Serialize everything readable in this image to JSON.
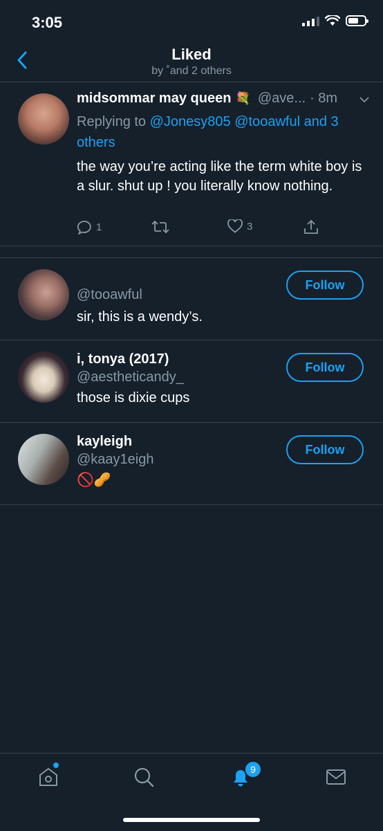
{
  "status_bar": {
    "time": "3:05"
  },
  "nav": {
    "title": "Liked",
    "subtitle": "by ˚and 2 others"
  },
  "tweet": {
    "name": "midsommar may queen",
    "name_emoji": "💐",
    "handle": "@ave...",
    "time": "· 8m",
    "replying_prefix": "Replying to ",
    "reply_mention_1": "@Jonesy805",
    "reply_mention_2": "@tooawful",
    "reply_others": "and 3 others",
    "body": "the way you’re acting like the term white boy is a slur. shut up ! you literally know nothing.",
    "reply_count": "1",
    "like_count": "3"
  },
  "users": [
    {
      "name": "",
      "handle": "@tooawful",
      "bio": "sir, this is a wendy’s.",
      "follow_label": "Follow"
    },
    {
      "name": "i, tonya (2017)",
      "handle": "@aestheticandy_",
      "bio": "those is dixie cups",
      "follow_label": "Follow"
    },
    {
      "name": "kayleigh",
      "handle": "@kaay1eigh",
      "bio": "🚫🥜",
      "follow_label": "Follow"
    }
  ],
  "tabbar": {
    "notifications_badge": "9"
  },
  "colors": {
    "background": "#15202b",
    "accent": "#1da1f2",
    "muted": "#8899a6",
    "divider": "#38444d"
  }
}
